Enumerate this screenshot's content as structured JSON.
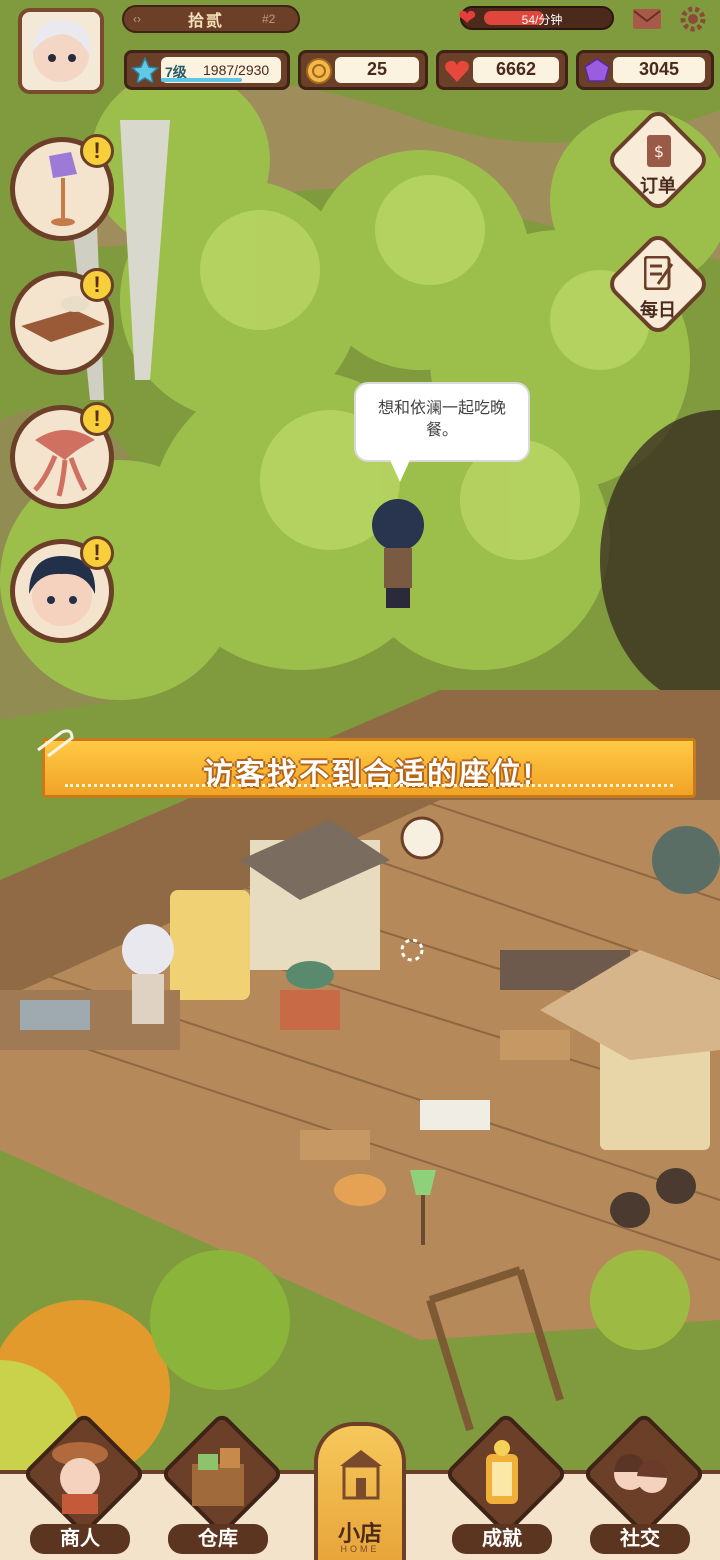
{
  "player": {
    "name": "拾贰",
    "rank": "#2",
    "level_text": "7级",
    "exp_text": "1987/2930",
    "exp_fraction": 0.678
  },
  "energy": {
    "rate_text": "54/分钟",
    "fill_fraction": 0.48
  },
  "resources": {
    "coins": "25",
    "hearts": "6662",
    "gems": "3045"
  },
  "side_buttons": {
    "orders": "订单",
    "daily": "每日"
  },
  "alerts": {
    "mark": "!"
  },
  "speech": {
    "text": "想和依澜一起吃晚餐。"
  },
  "banner": {
    "text": "访客找不到合适的座位!"
  },
  "nav": {
    "merchant": "商人",
    "warehouse": "仓库",
    "home": "小店",
    "home_sub": "HOME",
    "achievements": "成就",
    "social": "社交"
  },
  "colors": {
    "frame_brown": "#6b3f28",
    "banner_orange": "#f1a326",
    "alert_yellow": "#f7cf3b",
    "foliage_green": "#86a93e"
  }
}
